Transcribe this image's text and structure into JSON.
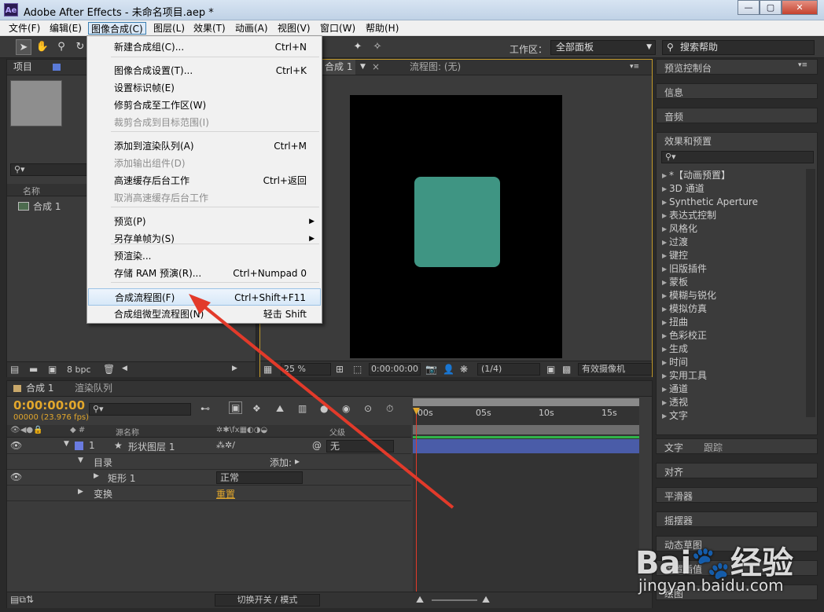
{
  "window": {
    "app_badge": "Ae",
    "title": "Adobe After Effects - 未命名项目.aep *",
    "minimize": "—",
    "maximize": "▢",
    "close": "✕"
  },
  "menubar": [
    {
      "label": "文件(F)"
    },
    {
      "label": "编辑(E)"
    },
    {
      "label": "图像合成(C)"
    },
    {
      "label": "图层(L)"
    },
    {
      "label": "效果(T)"
    },
    {
      "label": "动画(A)"
    },
    {
      "label": "视图(V)"
    },
    {
      "label": "窗口(W)"
    },
    {
      "label": "帮助(H)"
    }
  ],
  "toolbar": {
    "workspace_label": "工作区：",
    "workspace_value": "全部面板",
    "search_help": "搜索帮助"
  },
  "dropdown": {
    "items": [
      {
        "label": "新建合成组(C)...",
        "shortcut": "Ctrl+N",
        "disabled": false
      },
      {
        "label": "图像合成设置(T)...",
        "shortcut": "Ctrl+K",
        "disabled": false
      },
      {
        "label": "设置标识帧(E)",
        "shortcut": "",
        "disabled": false
      },
      {
        "label": "修剪合成至工作区(W)",
        "shortcut": "",
        "disabled": false
      },
      {
        "label": "裁剪合成到目标范围(I)",
        "shortcut": "",
        "disabled": true
      },
      {
        "label": "添加到渲染队列(A)",
        "shortcut": "Ctrl+M",
        "disabled": false
      },
      {
        "label": "添加输出组件(D)",
        "shortcut": "",
        "disabled": true
      },
      {
        "label": "高速缓存后台工作",
        "shortcut": "Ctrl+返回",
        "disabled": false
      },
      {
        "label": "取消高速缓存后台工作",
        "shortcut": "",
        "disabled": true
      },
      {
        "label": "预览(P)",
        "shortcut": "",
        "disabled": false
      },
      {
        "label": "另存单帧为(S)",
        "shortcut": "",
        "disabled": false
      },
      {
        "label": "预渲染...",
        "shortcut": "",
        "disabled": false
      },
      {
        "label": "存储 RAM 预演(R)...",
        "shortcut": "Ctrl+Numpad 0",
        "disabled": false
      },
      {
        "label": "合成流程图(F)",
        "shortcut": "Ctrl+Shift+F11",
        "disabled": false
      },
      {
        "label": "合成组微型流程图(N)",
        "shortcut": "轻击 Shift",
        "disabled": false
      }
    ]
  },
  "project_panel": {
    "tab": "项目",
    "col_name": "名称",
    "item": "合成 1",
    "bpc": "8 bpc"
  },
  "comp_viewer": {
    "tab_comp": "合成 1",
    "tab_flow": "流程图: (无)",
    "zoom": "25 %",
    "timecode": "0:00:00:00",
    "resolution": "(1/4)",
    "camera": "有效摄像机",
    "shape_color": "#3f9583"
  },
  "right_panels": {
    "preview": "预览控制台",
    "info": "信息",
    "audio": "音频",
    "effects": "效果和预置",
    "effects_list": [
      "*【动画预置】",
      "3D 通道",
      "Synthetic Aperture",
      "表达式控制",
      "风格化",
      "过渡",
      "键控",
      "旧版插件",
      "蒙板",
      "模糊与锐化",
      "模拟仿真",
      "扭曲",
      "色彩校正",
      "生成",
      "时间",
      "实用工具",
      "通道",
      "透视",
      "文字"
    ],
    "text": "文字",
    "track": "跟踪",
    "align": "对齐",
    "smoother": "平滑器",
    "wiggler": "摇摆器",
    "motion_sketch": "动态草图",
    "mask_interp": "遮罩插值",
    "paint": "绘图"
  },
  "timeline": {
    "tab_comp": "合成 1",
    "tab_render": "渲染队列",
    "timecode": "0:00:00:00",
    "fps": "00000 (23.976 fps)",
    "col_source": "源名称",
    "col_parent": "父级",
    "layer_index": "1",
    "layer_name": "形状图层 1",
    "parent_value": "无",
    "row_contents": "目录",
    "row_add": "添加:",
    "row_rect": "矩形 1",
    "row_blend": "正常",
    "row_transform": "变换",
    "row_reset": "重置",
    "ruler": [
      "00s",
      "05s",
      "10s",
      "15s"
    ],
    "toggle_label": "切换开关 / 模式"
  },
  "colors": {
    "accent_orange": "#e2a72c",
    "layer_bar": "#4a5ca8",
    "arrow_red": "#e23a2a"
  }
}
